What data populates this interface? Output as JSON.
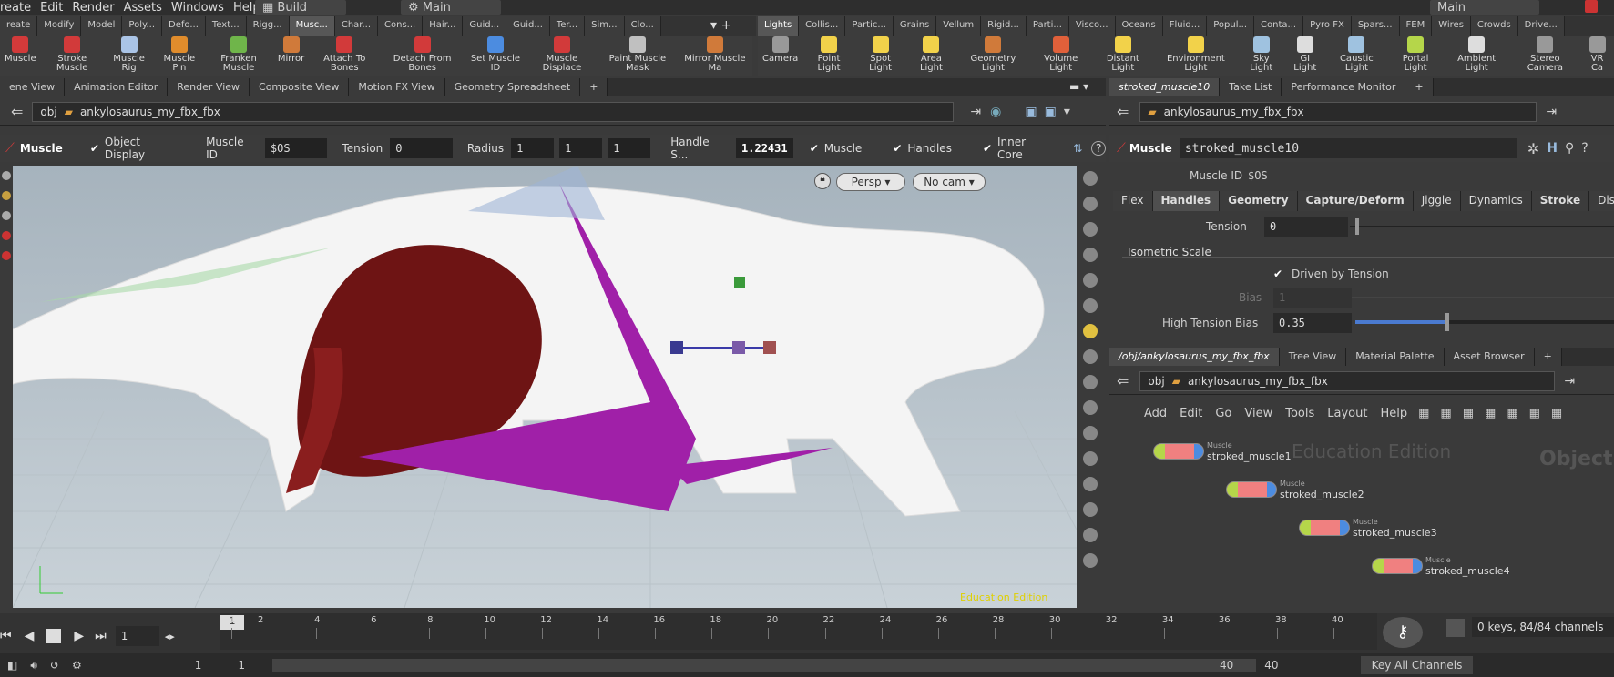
{
  "menu": {
    "items": [
      "reate",
      "Edit",
      "Render",
      "Assets",
      "Windows",
      "Help"
    ],
    "desktop_label": "Build",
    "main_label": "Main",
    "main_label_right": "Main"
  },
  "shelf_tabs_left": [
    "reate",
    "Modify",
    "Model",
    "Poly...",
    "Defo...",
    "Text...",
    "Rigg...",
    "Musc...",
    "Char...",
    "Cons...",
    "Hair...",
    "Guid...",
    "Guid...",
    "Ter...",
    "Sim...",
    "Clo..."
  ],
  "shelf_tools_left": [
    {
      "label": "Muscle",
      "color": "#d23a3a"
    },
    {
      "label": "Stroke Muscle",
      "color": "#d23a3a"
    },
    {
      "label": "Muscle Rig",
      "color": "#aac4e6"
    },
    {
      "label": "Muscle Pin",
      "color": "#e08c2c"
    },
    {
      "label": "Franken Muscle",
      "color": "#6fb54a"
    },
    {
      "label": "Mirror",
      "color": "#d07a3a"
    },
    {
      "label": "Attach To Bones",
      "color": "#d23a3a"
    },
    {
      "label": "Detach From Bones",
      "color": "#d23a3a"
    },
    {
      "label": "Set Muscle ID",
      "color": "#4c8ce0"
    },
    {
      "label": "Muscle Displace",
      "color": "#d23a3a"
    },
    {
      "label": "Paint Muscle Mask",
      "color": "#c0c0c0"
    },
    {
      "label": "Mirror Muscle Ma",
      "color": "#d07a3a"
    }
  ],
  "shelf_tabs_right": [
    "Lights",
    "Collis...",
    "Partic...",
    "Grains",
    "Vellum",
    "Rigid...",
    "Parti...",
    "Visco...",
    "Oceans",
    "Fluid...",
    "Popul...",
    "Conta...",
    "Pyro FX",
    "Spars...",
    "FEM",
    "Wires",
    "Crowds",
    "Drive..."
  ],
  "shelf_tools_right": [
    {
      "label": "Camera",
      "color": "#999"
    },
    {
      "label": "Point Light",
      "color": "#f2d24a"
    },
    {
      "label": "Spot Light",
      "color": "#f2d24a"
    },
    {
      "label": "Area Light",
      "color": "#f2d24a"
    },
    {
      "label": "Geometry Light",
      "color": "#d07a3a"
    },
    {
      "label": "Volume Light",
      "color": "#e0603a"
    },
    {
      "label": "Distant Light",
      "color": "#f2d24a"
    },
    {
      "label": "Environment Light",
      "color": "#f2d24a"
    },
    {
      "label": "Sky Light",
      "color": "#9fc2e0"
    },
    {
      "label": "GI Light",
      "color": "#ddd"
    },
    {
      "label": "Caustic Light",
      "color": "#9fc2e0"
    },
    {
      "label": "Portal Light",
      "color": "#b5d64a"
    },
    {
      "label": "Ambient Light",
      "color": "#ddd"
    },
    {
      "label": "Stereo Camera",
      "color": "#999"
    },
    {
      "label": "VR Ca",
      "color": "#999"
    }
  ],
  "left_pane_tabs": [
    "ene View",
    "Animation Editor",
    "Render View",
    "Composite View",
    "Motion FX View",
    "Geometry Spreadsheet"
  ],
  "left_path": {
    "context": "obj",
    "node": "ankylosaurus_my_fbx_fbx"
  },
  "op_bar": {
    "title": "Muscle",
    "object_display": "Object Display",
    "muscle_id_label": "Muscle ID",
    "muscle_id_value": "$OS",
    "tension_label": "Tension",
    "tension_value": "0",
    "radius_label": "Radius",
    "radius_values": [
      "1",
      "1",
      "1"
    ],
    "handle_label": "Handle S...",
    "handle_value": "1.22431",
    "muscle_check": "Muscle",
    "handles_check": "Handles",
    "inner_core_check": "Inner Core"
  },
  "viewport": {
    "persp": "Persp",
    "cam": "No cam",
    "watermark": "Education Edition"
  },
  "right_top_tabs": [
    "stroked_muscle10",
    "Take List",
    "Performance Monitor"
  ],
  "right_path": {
    "node": "ankylosaurus_my_fbx_fbx"
  },
  "params": {
    "type": "Muscle",
    "name": "stroked_muscle10",
    "muscle_id_label": "Muscle ID",
    "muscle_id_value": "$OS",
    "tabs": [
      "Flex",
      "Handles",
      "Geometry",
      "Capture/Deform",
      "Jiggle",
      "Dynamics",
      "Stroke",
      "Display"
    ],
    "tension_label": "Tension",
    "tension_value": "0",
    "iso_label": "Isometric Scale",
    "driven_label": "Driven by Tension",
    "bias_label": "Bias",
    "bias_value": "1",
    "htb_label": "High Tension Bias",
    "htb_value": "0.35",
    "htb_fraction": 0.35
  },
  "network_tabs": [
    "/obj/ankylosaurus_my_fbx_fbx",
    "Tree View",
    "Material Palette",
    "Asset Browser"
  ],
  "network_path": {
    "context": "obj",
    "node": "ankylosaurus_my_fbx_fbx"
  },
  "network_menu": [
    "Add",
    "Edit",
    "Go",
    "View",
    "Tools",
    "Layout",
    "Help"
  ],
  "network": {
    "watermark": "Education Edition",
    "context_label": "Object",
    "nodes": [
      {
        "type": "Muscle",
        "name": "stroked_muscle1"
      },
      {
        "type": "Muscle",
        "name": "stroked_muscle2"
      },
      {
        "type": "Muscle",
        "name": "stroked_muscle3"
      },
      {
        "type": "Muscle",
        "name": "stroked_muscle4"
      }
    ]
  },
  "timeline": {
    "current_frame": "1",
    "frame_marker": "1",
    "ticks": [
      "1",
      "2",
      "4",
      "6",
      "8",
      "10",
      "12",
      "14",
      "16",
      "18",
      "20",
      "22",
      "24",
      "26",
      "28",
      "30",
      "32",
      "34",
      "36",
      "38",
      "40"
    ],
    "start": "1",
    "start2": "1",
    "end": "40",
    "end2": "40",
    "keys_info": "0 keys, 84/84 channels",
    "key_all": "Key All Channels"
  }
}
